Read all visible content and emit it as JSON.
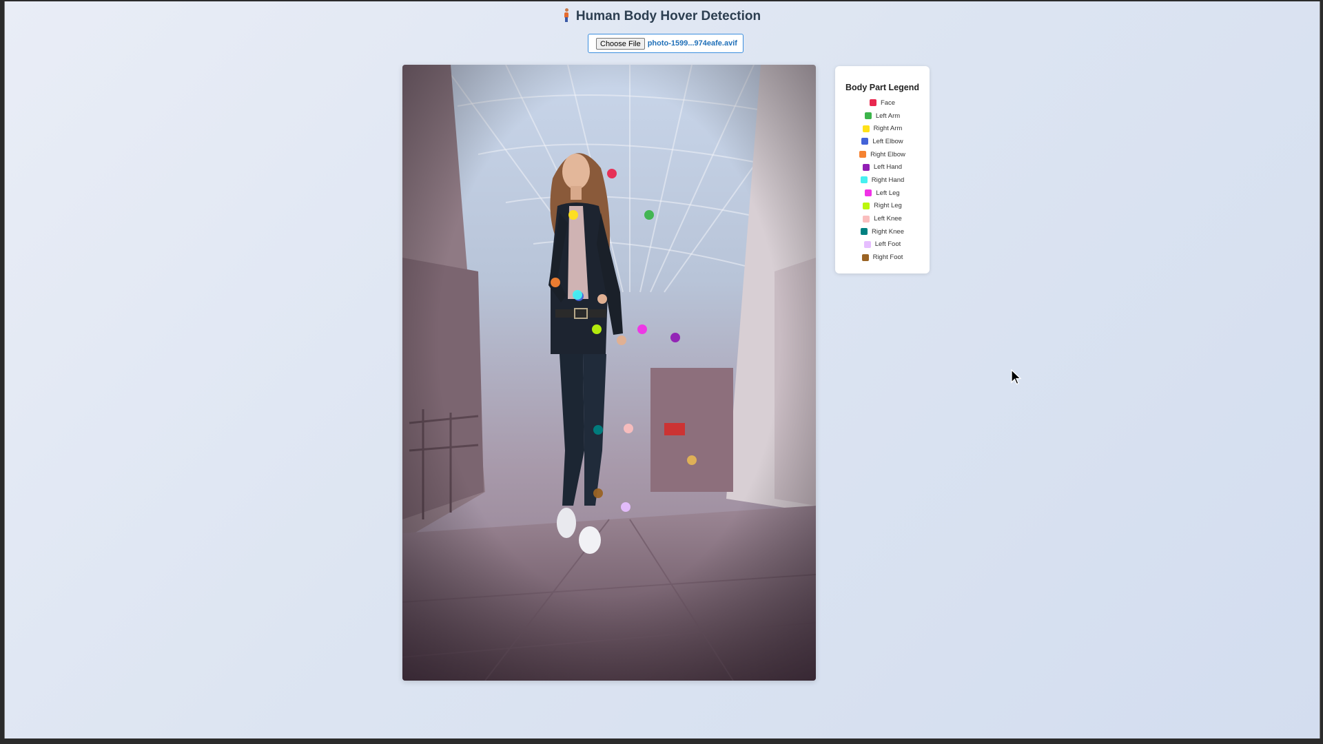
{
  "page": {
    "title": "Human Body Hover Detection",
    "title_icon": "person-icon"
  },
  "file_input": {
    "button_label": "Choose File",
    "file_name": "photo-1599...974eafe.avif"
  },
  "photo": {
    "subject": "photo of a woman walking in a glass-roofed arcade",
    "keypoints": [
      {
        "part": "Face",
        "color": "#e8284f"
      },
      {
        "part": "Left Arm",
        "color": "#3cb44b"
      },
      {
        "part": "Right Arm",
        "color": "#ffe119"
      },
      {
        "part": "Left Elbow",
        "color": "#4363d8"
      },
      {
        "part": "Right Elbow",
        "color": "#f58231"
      },
      {
        "part": "Left Hand",
        "color": "#911eb4"
      },
      {
        "part": "Right Hand",
        "color": "#46f0f0"
      },
      {
        "part": "Left Leg",
        "color": "#f032e6"
      },
      {
        "part": "Right Leg",
        "color": "#bcf60c"
      },
      {
        "part": "Left Knee",
        "color": "#fabebe"
      },
      {
        "part": "Right Knee",
        "color": "#008080"
      },
      {
        "part": "Left Foot",
        "color": "#e6beff"
      },
      {
        "part": "Right Foot",
        "color": "#9a6324"
      }
    ]
  },
  "legend": {
    "title": "Body Part Legend",
    "items": [
      {
        "label": "Face",
        "color": "#e8284f"
      },
      {
        "label": "Left Arm",
        "color": "#3cb44b"
      },
      {
        "label": "Right Arm",
        "color": "#ffe119"
      },
      {
        "label": "Left Elbow",
        "color": "#4363d8"
      },
      {
        "label": "Right Elbow",
        "color": "#f58231"
      },
      {
        "label": "Left Hand",
        "color": "#911eb4"
      },
      {
        "label": "Right Hand",
        "color": "#46f0f0"
      },
      {
        "label": "Left Leg",
        "color": "#f032e6"
      },
      {
        "label": "Right Leg",
        "color": "#bcf60c"
      },
      {
        "label": "Left Knee",
        "color": "#fabebe"
      },
      {
        "label": "Right Knee",
        "color": "#008080"
      },
      {
        "label": "Left Foot",
        "color": "#e6beff"
      },
      {
        "label": "Right Foot",
        "color": "#9a6324"
      }
    ]
  }
}
